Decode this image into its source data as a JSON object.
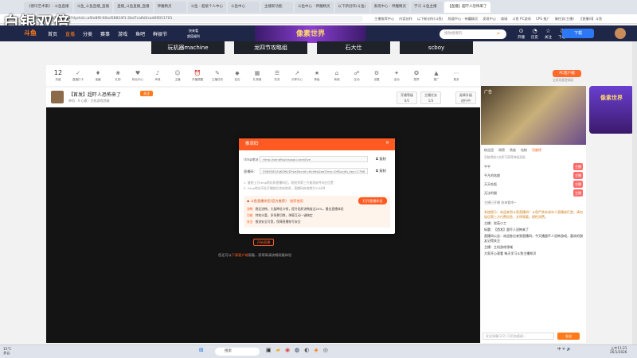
{
  "watermark": "白银双倍",
  "browser": {
    "tabs": [
      "《德玛艺术家》- 斗鱼直播",
      "斗鱼_斗鱼直播_直播",
      "直播_斗鱼直播_直播",
      "神魔精灵",
      "斗鱼 - 超级个人中心",
      "斗鱼中心",
      "主播新功能",
      "斗鱼中心 - 神魔精灵",
      "以下新创作(斗鱼)",
      "发现中心 - 神魔精灵",
      "学习 斗鱼主播",
      "【直播】超吓人恐怖来了"
    ],
    "active_tab": 11,
    "url": "douyu.com/5898583?dyshid=af4e8f8-00ed58824f1-2bd7ca8d2cad09011701",
    "bookmarks": [
      "主播推荐中心",
      "内容创作",
      "以下新创作(斗鱼)",
      "频道中心 - 神魔精灵",
      "发现中心",
      "商城",
      "斗鱼 PC游戏",
      "CPS 推广",
      "做任务(主播)",
      "【直播间】斗鱼"
    ]
  },
  "nav": {
    "logo": "斗鱼",
    "links": [
      "首页",
      "直播",
      "分类",
      "赛事",
      "游戏",
      "鱼吧",
      "鲜娱节"
    ],
    "active": 1,
    "promo_line1": "快来看",
    "promo_line2": "超值福利",
    "banner": "像素世界",
    "search_placeholder": "搜你想要的",
    "right_items": [
      {
        "icon": "⊙",
        "label": "开播"
      },
      {
        "icon": "◔",
        "label": "历史"
      },
      {
        "icon": "☆",
        "label": "关注"
      },
      {
        "icon": "⇩",
        "label": "下载"
      }
    ],
    "download_button": "下载"
  },
  "categories": [
    "玩机器machine",
    "龙四节攻略组",
    "石大仕",
    "scboy"
  ],
  "iconbar": {
    "rank_value": "12",
    "rank_label": "热度",
    "items": [
      "直播打卡",
      "宝藏",
      "礼物",
      "粉丝中心",
      "声浪",
      "主播",
      "开播提醒",
      "主播任务",
      "钻石",
      "礼物墙",
      "任务",
      "分享中心",
      "等级",
      "商城",
      "互动",
      "设置",
      "活动",
      "勋章",
      "推广",
      "更多"
    ],
    "pc_button": "PC客户端",
    "pc_subtitle": "全屏观看更精彩"
  },
  "streamer": {
    "title": "【首发】超吓人恐怖来了",
    "badge": "关注",
    "subtitle": "单机 · 0  心跳 · 主机游戏领域",
    "stats": [
      {
        "line1": "开播等级",
        "line2": "0/1"
      },
      {
        "line1": "主播任务",
        "line2": "1/3"
      },
      {
        "line1": "勋章升级",
        "line2": "进行中"
      }
    ]
  },
  "dialog": {
    "title": "推流码",
    "close": "×",
    "rtmp_label": "rtmp地址:",
    "rtmp_value": "rtmp://sendfsw.kssopu.com/live",
    "code_label": "直播码:",
    "code_value": "5989581/hJK0WvD?wsSecret=6cd9a&wsTime=0ff&auth_key=1786",
    "copy": "复制",
    "tip1": "1. 复制上方rtmp地址和直播码后，粘贴到第三方推流软件对应位置",
    "tip2": "2. rtmp地址可在开播前后完成修改，直播码有效期为10分钟",
    "tip_title": "斗鱼直播伴侣(官方推荐)",
    "tip_title_badge": "推荐使用",
    "open_tool": "打开直播伴侣",
    "tip_lines": [
      {
        "tag": "流畅",
        "text": "稳定流畅，大量降低卡顿，提升画质流畅度达20%，最佳直播体验"
      },
      {
        "tag": "功能",
        "text": "特效丰富，多场景切换，弹幕互动一键搞定"
      },
      {
        "tag": "安全",
        "text": "推流安全可靠，保障直播账号安全"
      }
    ],
    "start_button": "开始直播",
    "below_prefix": "您还可以",
    "below_link": "下载客户端",
    "below_suffix": "观看，获得高清流畅观看体验"
  },
  "sidebar": {
    "ad_label": "广告",
    "tabs": [
      "粉丝团",
      "周榜",
      "贵族",
      "钻粉",
      "贡献榜"
    ],
    "active_tab": 4,
    "rank_header": "贡献榜前3名即可获得神秘奖励",
    "rank_rows": [
      {
        "name": "平平",
        "badge": "主播"
      },
      {
        "name": "平凡的姑娘",
        "badge": "主播"
      },
      {
        "name": "天天吃饭",
        "badge": "主播"
      },
      {
        "name": "无法的猫",
        "badge": "主播"
      }
    ],
    "notice": "主播已开播 快来看吧~",
    "chat": [
      {
        "text": "系统提示：欢迎来到斗鱼直播间！斗鱼严禁未成年人直播或打赏，请勿轻信第三方付费信息，文明观看，理性消费。",
        "orange": true
      },
      {
        "text": "主播：驳苑小工",
        "orange": false
      },
      {
        "text": "标题：【首发】超吓人恐怖来了",
        "orange": false
      },
      {
        "text": "直播间公告：欢迎各位来到直播间，今天播超吓人恐怖游戏，喜欢的朋友记得关注",
        "orange": false
      },
      {
        "text": "主播：主机游戏领域",
        "orange": false
      },
      {
        "text": "大家开心观看 每天学习斗鱼主播知识",
        "orange": false
      }
    ],
    "chat_input": "发送弹幕(2/2) 可用快捷键~",
    "send": "发送"
  },
  "right_ad": "像素世界",
  "taskbar": {
    "weather_temp": "15°C",
    "weather_desc": "多云",
    "search": "搜索",
    "tray": "中 ᯤ 🔊",
    "time": "上午11:21",
    "date": "26/1/2026"
  }
}
